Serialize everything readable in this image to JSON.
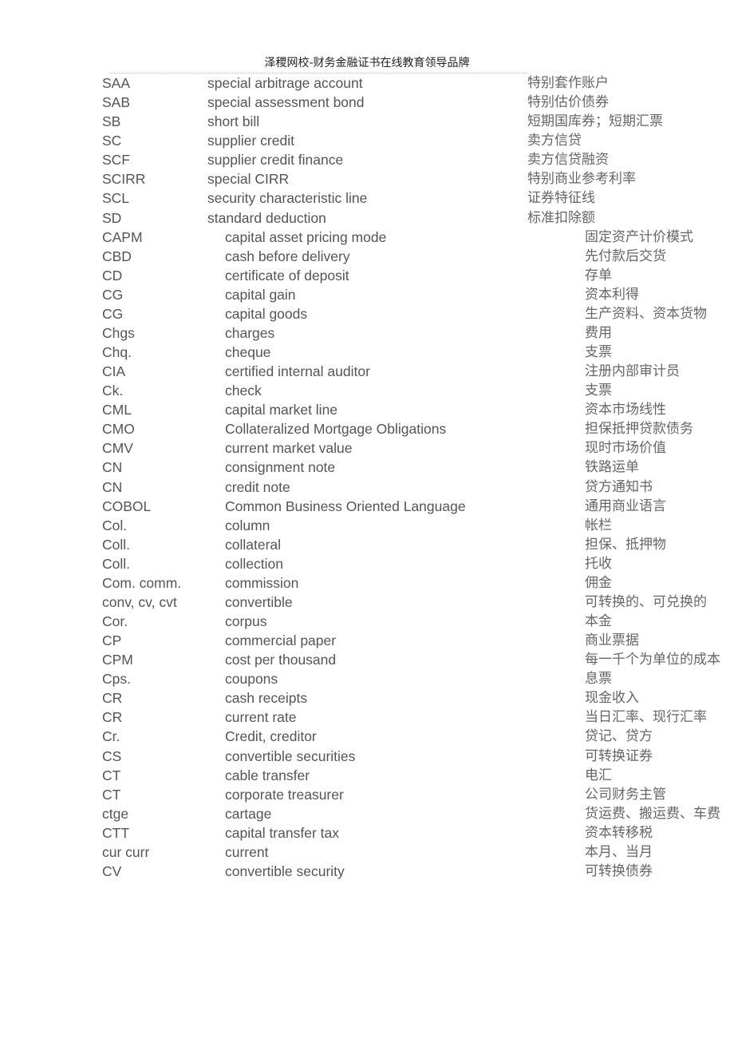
{
  "header": {
    "title": "泽稷网校-财务金融证书在线教育领导品牌"
  },
  "group1": [
    {
      "abbr": "SAA",
      "term": "special  arbitrage account",
      "cn": "特别套作账户"
    },
    {
      "abbr": "SAB",
      "term": "special  assessment bond",
      "cn": "特别估价债券"
    },
    {
      "abbr": "SB",
      "term": "short  bill",
      "cn": "短期国库券；短期汇票"
    },
    {
      "abbr": "SC",
      "term": "supplier  credit",
      "cn": "卖方信贷"
    },
    {
      "abbr": "SCF",
      "term": "supplier  credit finance",
      "cn": "卖方信贷融资"
    },
    {
      "abbr": "SCIRR",
      "term": "special  CIRR",
      "cn": "特别商业参考利率"
    },
    {
      "abbr": "SCL",
      "term": "security  characteristic line",
      "cn": "证券特征线"
    },
    {
      "abbr": "SD",
      "term": "standard  deduction",
      "cn": "标准扣除额"
    }
  ],
  "group2": [
    {
      "abbr": "CAPM",
      "term": "capital asset  pricing mode",
      "cn": "固定资产计价模式"
    },
    {
      "abbr": "CBD",
      "term": "cash  before delivery",
      "cn": "先付款后交货"
    },
    {
      "abbr": "CD",
      "term": "certificate  of deposit",
      "cn": "存单"
    },
    {
      "abbr": "CG",
      "term": "capital  gain",
      "cn": "资本利得"
    },
    {
      "abbr": "CG",
      "term": "capital  goods",
      "cn": "生产资料、资本货物"
    },
    {
      "abbr": "Chgs",
      "term": "charges",
      "cn": "费用"
    },
    {
      "abbr": "Chq.",
      "term": "cheque",
      "cn": "支票"
    },
    {
      "abbr": "CIA",
      "term": "certified  internal auditor",
      "cn": "注册内部审计员"
    },
    {
      "abbr": "Ck.",
      "term": "check",
      "cn": "支票"
    },
    {
      "abbr": "CML",
      "term": "capital  market line",
      "cn": "资本市场线性"
    },
    {
      "abbr": "CMO",
      "term": "Collateralized  Mortgage Obligations",
      "cn": "担保抵押贷款债务"
    },
    {
      "abbr": "CMV",
      "term": "current  market value",
      "cn": "现时市场价值"
    },
    {
      "abbr": "CN",
      "term": "consignment  note",
      "cn": "铁路运单"
    },
    {
      "abbr": "CN",
      "term": "credit  note",
      "cn": "贷方通知书"
    },
    {
      "abbr": "COBOL",
      "term": "Common  Business Oriented Language",
      "cn": "通用商业语言"
    },
    {
      "abbr": "Col.",
      "term": "column",
      "cn": "帐栏"
    },
    {
      "abbr": "Coll.",
      "term": "collateral",
      "cn": "担保、抵押物"
    },
    {
      "abbr": "Coll.",
      "term": "collection",
      "cn": "托收"
    },
    {
      "abbr": "Com. comm.",
      "term": "commission",
      "cn": "佣金"
    },
    {
      "abbr": "conv, cv, cvt",
      "term": "convertible",
      "cn": "可转换的、可兑换的"
    },
    {
      "abbr": "Cor.",
      "term": "corpus",
      "cn": "本金"
    },
    {
      "abbr": "CP",
      "term": "commercial  paper",
      "cn": "商业票据"
    },
    {
      "abbr": "CPM",
      "term": "cost  per thousand",
      "cn": "每一千个为单位的成本"
    },
    {
      "abbr": "Cps.",
      "term": "coupons",
      "cn": "息票"
    },
    {
      "abbr": "CR",
      "term": "cash  receipts",
      "cn": "现金收入"
    },
    {
      "abbr": "CR",
      "term": "current  rate",
      "cn": "当日汇率、现行汇率"
    },
    {
      "abbr": "Cr.",
      "term": "Credit,  creditor",
      "cn": "贷记、贷方"
    },
    {
      "abbr": "CS",
      "term": "convertible  securities",
      "cn": "可转换证券"
    },
    {
      "abbr": "CT",
      "term": "cable  transfer",
      "cn": "电汇"
    },
    {
      "abbr": "CT",
      "term": "corporate  treasurer",
      "cn": "公司财务主管"
    },
    {
      "abbr": "ctge",
      "term": "cartage",
      "cn": "货运费、搬运费、车费"
    },
    {
      "abbr": "CTT",
      "term": "capital  transfer tax",
      "cn": "资本转移税"
    },
    {
      "abbr": "cur curr",
      "term": "current",
      "cn": "本月、当月"
    },
    {
      "abbr": "CV",
      "term": "convertible  security",
      "cn": "可转换债券"
    }
  ]
}
